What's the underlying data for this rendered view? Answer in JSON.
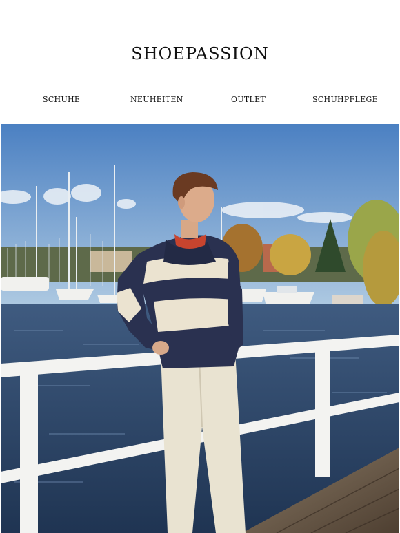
{
  "brand": {
    "logo_text": "SHOEPASSION"
  },
  "nav": {
    "items": [
      {
        "label": "SCHUHE"
      },
      {
        "label": "NEUHEITEN"
      },
      {
        "label": "OUTLET"
      },
      {
        "label": "SCHUHPFLEGE"
      }
    ]
  },
  "hero": {
    "colors": {
      "sky_top": "#4f84c4",
      "sky_bottom": "#a9c6e0",
      "water": "#2b4466",
      "sweater_navy": "#2a3150",
      "sweater_cream": "#ece4d2",
      "trousers": "#e8e2cf",
      "railing": "#f2f2f0",
      "dock": "#6b5a48"
    }
  }
}
